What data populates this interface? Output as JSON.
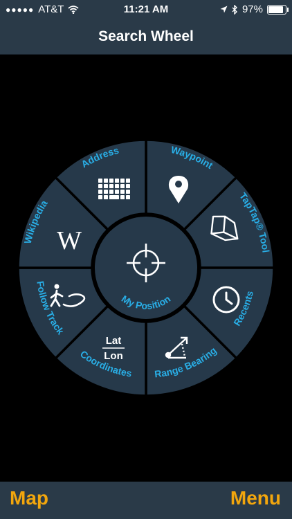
{
  "status": {
    "carrier": "AT&T",
    "time": "11:21 AM",
    "battery_percent": "97%",
    "battery_level": 0.97
  },
  "header": {
    "title": "Search Wheel"
  },
  "wheel": {
    "center_label": "My Position",
    "segments": {
      "address": "Address",
      "waypoint": "Waypoint",
      "taptap_tool": "TapTap® Tool",
      "recents": "Recents",
      "range_bearing": "Range Bearing",
      "coordinates": "Coordinates",
      "follow_track": "Follow Track",
      "wikipedia": "Wikipedia"
    },
    "coord_icon_top": "Lat",
    "coord_icon_bottom": "Lon",
    "wiki_letter": "W"
  },
  "footer": {
    "left": "Map",
    "right": "Menu"
  },
  "colors": {
    "segment_fill": "#26394a",
    "label": "#29aee6",
    "accent": "#f2a60d",
    "bar": "#2a3a48"
  }
}
